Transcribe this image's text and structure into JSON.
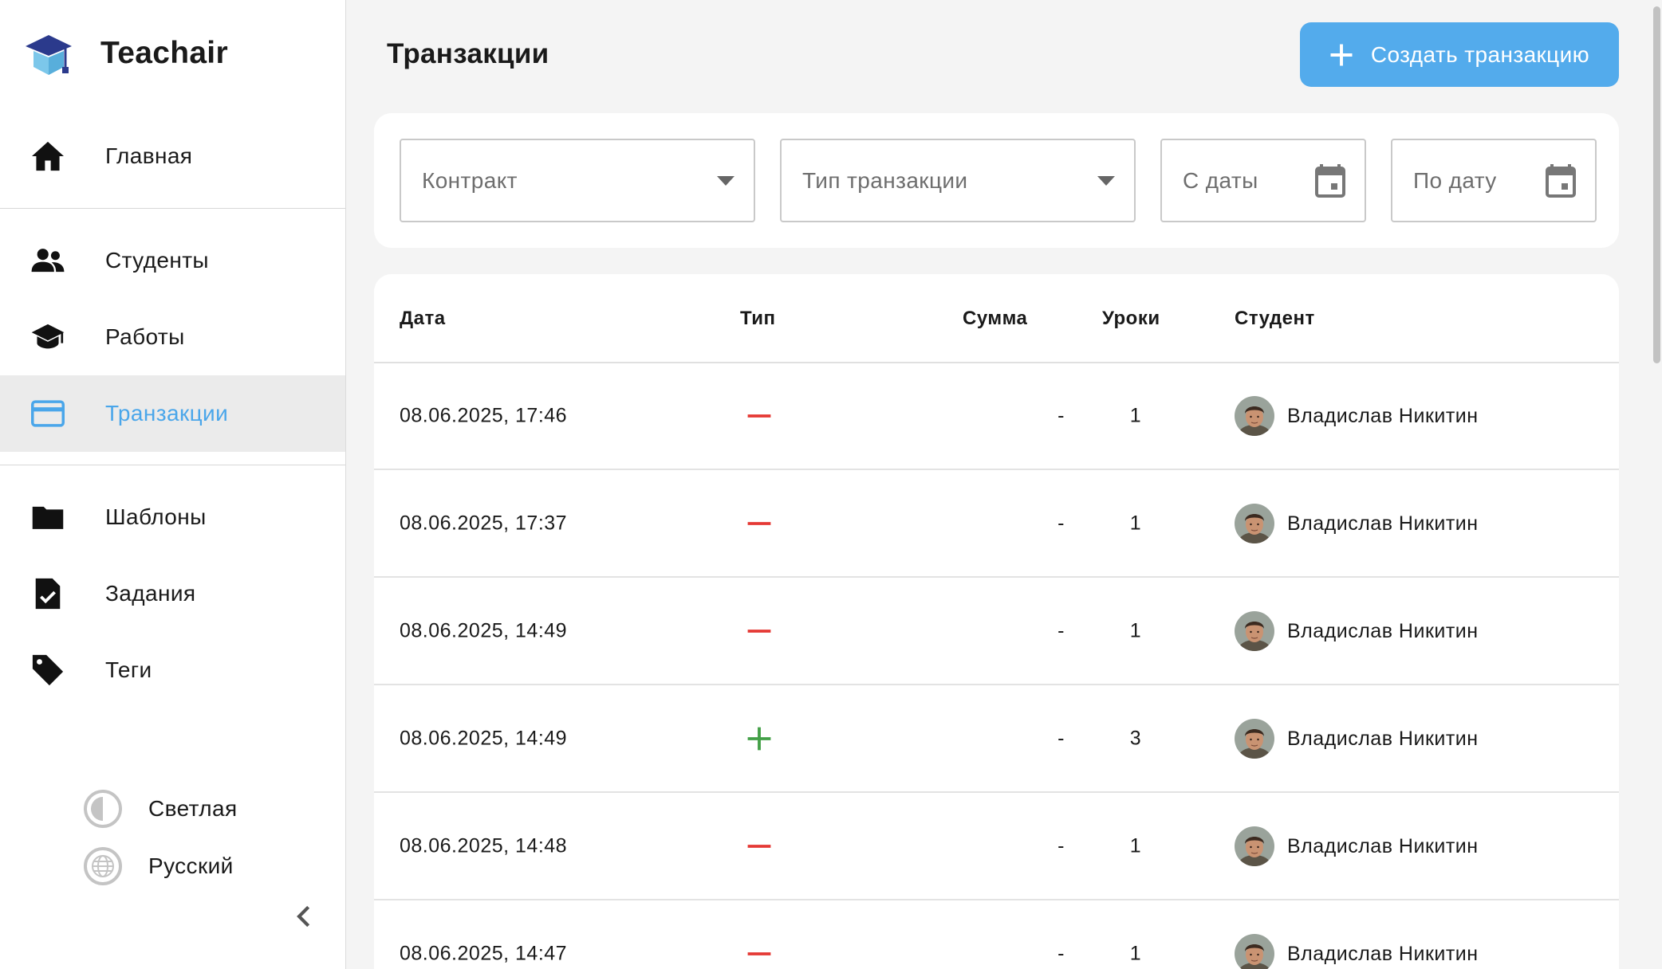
{
  "brand": {
    "name": "Teachair"
  },
  "nav": {
    "home": "Главная",
    "students": "Студенты",
    "works": "Работы",
    "transactions": "Транзакции",
    "templates": "Шаблоны",
    "tasks": "Задания",
    "tags": "Теги"
  },
  "settings": {
    "theme": "Светлая",
    "language": "Русский"
  },
  "page": {
    "title": "Транзакции",
    "create_label": "Создать транзакцию"
  },
  "filters": {
    "contract": "Контракт",
    "transaction_type": "Тип транзакции",
    "date_from": "С даты",
    "date_to": "По дату"
  },
  "table": {
    "headers": {
      "date": "Дата",
      "type": "Тип",
      "sum": "Сумма",
      "lessons": "Уроки",
      "student": "Студент"
    },
    "rows": [
      {
        "date": "08.06.2025, 17:46",
        "type": "minus",
        "sum": "-",
        "lessons": "1",
        "student": "Владислав Никитин"
      },
      {
        "date": "08.06.2025, 17:37",
        "type": "minus",
        "sum": "-",
        "lessons": "1",
        "student": "Владислав Никитин"
      },
      {
        "date": "08.06.2025, 14:49",
        "type": "minus",
        "sum": "-",
        "lessons": "1",
        "student": "Владислав Никитин"
      },
      {
        "date": "08.06.2025, 14:49",
        "type": "plus",
        "sum": "-",
        "lessons": "3",
        "student": "Владислав Никитин"
      },
      {
        "date": "08.06.2025, 14:48",
        "type": "minus",
        "sum": "-",
        "lessons": "1",
        "student": "Владислав Никитин"
      },
      {
        "date": "08.06.2025, 14:47",
        "type": "minus",
        "sum": "-",
        "lessons": "1",
        "student": "Владислав Никитин"
      }
    ]
  },
  "colors": {
    "accent": "#53abec",
    "active_text": "#4aa6ea",
    "minus": "#e53935",
    "plus": "#43a047"
  },
  "icons": {
    "home": "home-icon",
    "students": "people-icon",
    "works": "graduation-cap-icon",
    "transactions": "credit-card-icon",
    "templates": "folder-icon",
    "tasks": "task-check-icon",
    "tags": "tag-icon",
    "theme": "contrast-icon",
    "language": "globe-icon",
    "collapse": "chevron-left-icon",
    "dropdown": "caret-down-icon",
    "calendar": "calendar-icon"
  }
}
